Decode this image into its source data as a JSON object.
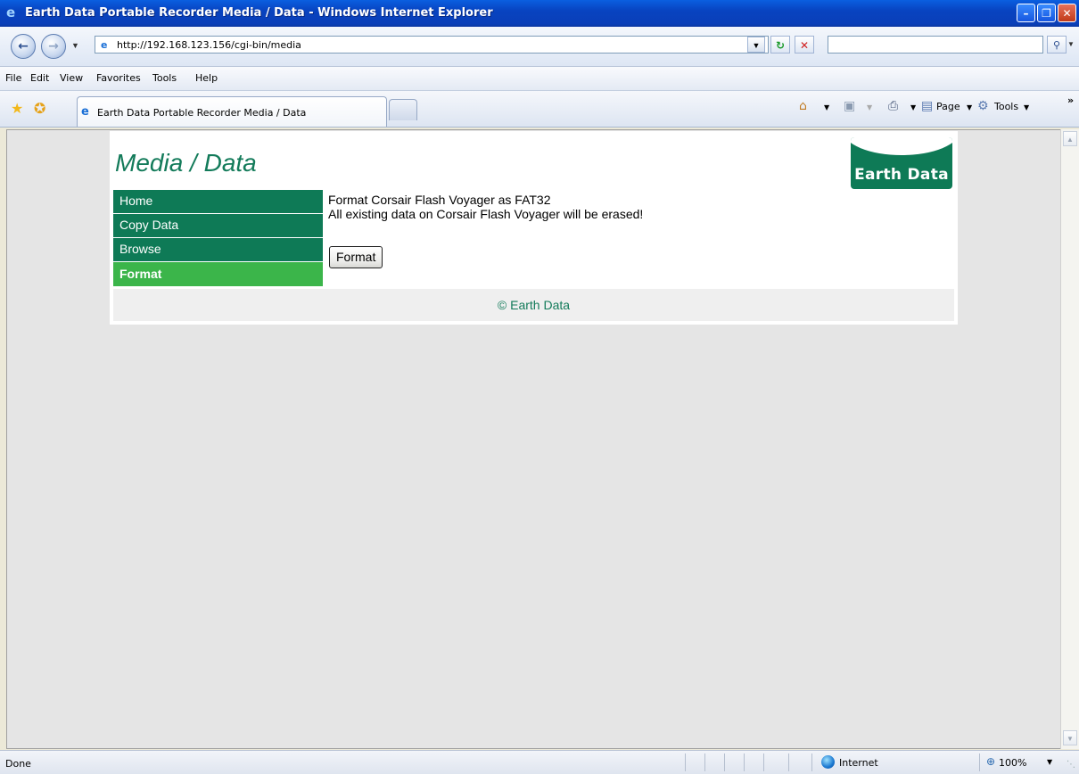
{
  "window": {
    "title": "Earth Data Portable Recorder Media / Data - Windows Internet Explorer",
    "minimize": "–",
    "restore": "❐",
    "close": "✕"
  },
  "address_bar": {
    "url": "http://192.168.123.156/cgi-bin/media",
    "search_placeholder": ""
  },
  "menu": [
    "File",
    "Edit",
    "View",
    "Favorites",
    "Tools",
    "Help"
  ],
  "tab": {
    "label": "Earth Data Portable Recorder Media / Data"
  },
  "command_bar": {
    "page": "Page",
    "tools": "Tools"
  },
  "page": {
    "title": "Media / Data",
    "logo_text": "Earth Data",
    "nav": [
      {
        "label": "Home",
        "active": false
      },
      {
        "label": "Copy Data",
        "active": false
      },
      {
        "label": "Browse",
        "active": false
      },
      {
        "label": "Format",
        "active": true
      }
    ],
    "message_line1": "Format Corsair Flash Voyager as FAT32",
    "message_line2": "All existing data on Corsair Flash Voyager will be erased!",
    "format_button": "Format",
    "footer": "© Earth Data"
  },
  "status_bar": {
    "status": "Done",
    "zone": "Internet",
    "zoom": "100%"
  },
  "colors": {
    "nav_green": "#0e7a56",
    "nav_active": "#3bb54a",
    "title_green": "#137b5a"
  }
}
